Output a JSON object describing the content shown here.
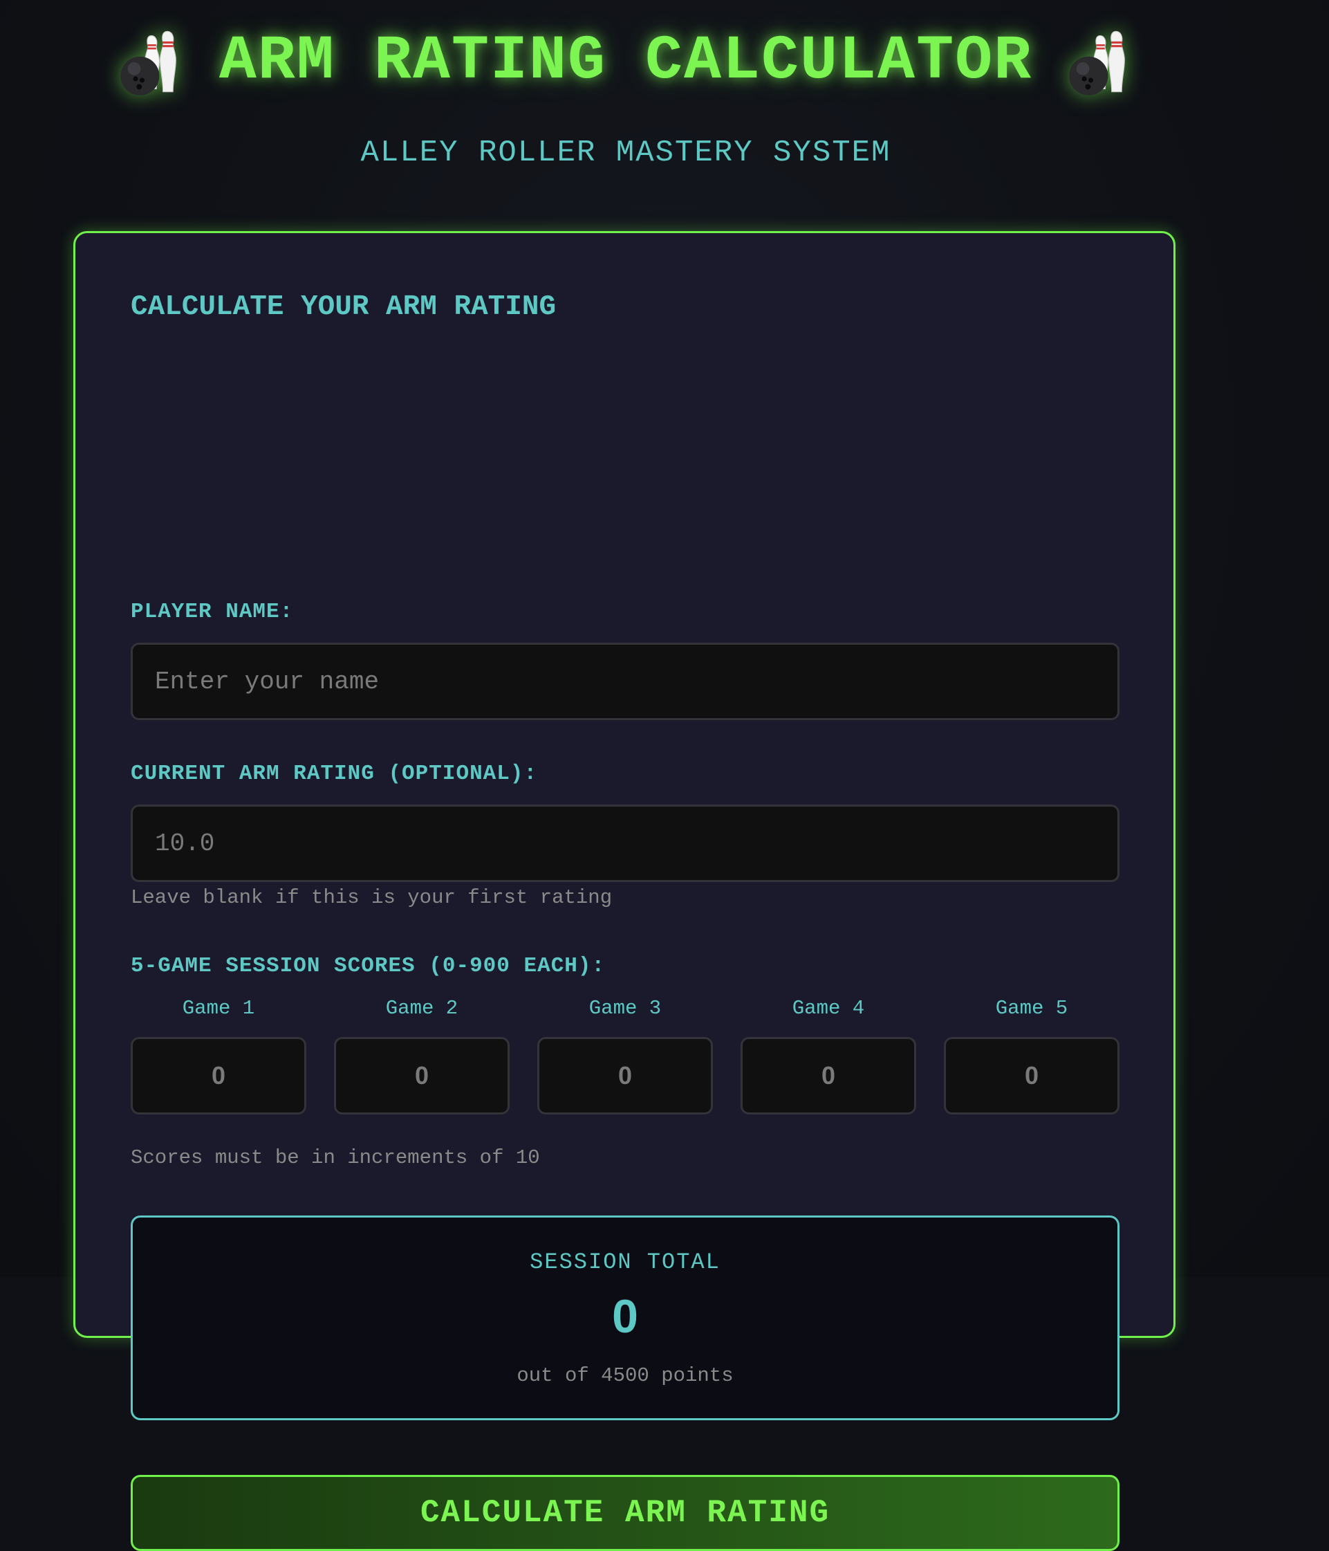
{
  "header": {
    "title": "ARM RATING CALCULATOR",
    "subtitle": "ALLEY ROLLER MASTERY SYSTEM",
    "left_icon": "bowling-icon",
    "right_icon": "bowling-icon"
  },
  "form": {
    "heading": "CALCULATE YOUR ARM RATING",
    "player_name": {
      "label": "PLAYER NAME:",
      "value": "",
      "placeholder": "Enter your name"
    },
    "current_rating": {
      "label": "CURRENT ARM RATING (OPTIONAL):",
      "value": "",
      "placeholder": "10.0",
      "hint": "Leave blank if this is your first rating"
    },
    "scores": {
      "label": "5-GAME SESSION SCORES (0-900 EACH):",
      "games": [
        {
          "label": "Game 1",
          "value": "",
          "placeholder": "0"
        },
        {
          "label": "Game 2",
          "value": "",
          "placeholder": "0"
        },
        {
          "label": "Game 3",
          "value": "",
          "placeholder": "0"
        },
        {
          "label": "Game 4",
          "value": "",
          "placeholder": "0"
        },
        {
          "label": "Game 5",
          "value": "",
          "placeholder": "0"
        }
      ],
      "hint": "Scores must be in increments of 10"
    },
    "session_total": {
      "label": "SESSION TOTAL",
      "value": "0",
      "sub": "out of 4500 points"
    },
    "calculate_button": "CALCULATE ARM RATING"
  },
  "colors": {
    "accent_green": "#7cf552",
    "accent_teal": "#5ec8c4",
    "card_bg": "#1b1a2c",
    "page_bg": "#0f1116"
  }
}
